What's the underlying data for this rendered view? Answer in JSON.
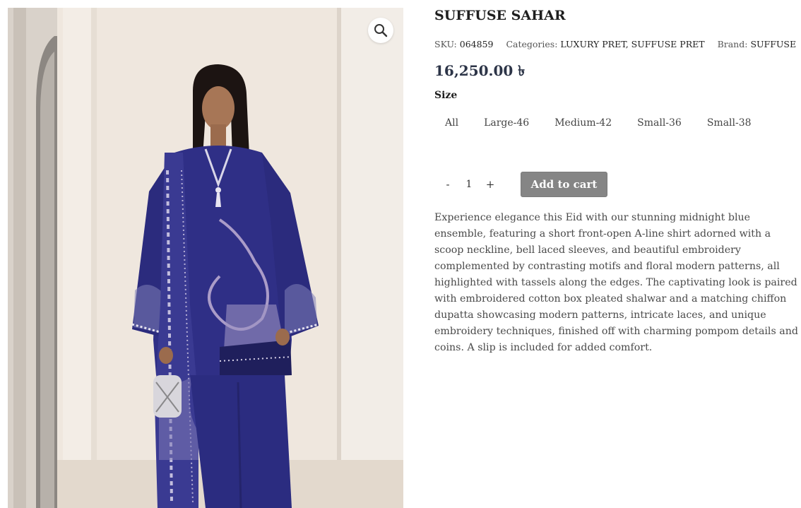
{
  "product": {
    "title": "SUFFUSE SAHAR",
    "sku_label": "SKU:",
    "sku": "064859",
    "categories_label": "Categories:",
    "categories": "LUXURY PRET, SUFFUSE PRET",
    "brand_label": "Brand:",
    "brand": "SUFFUSE",
    "price": "16,250.00 ৳",
    "description": "Experience elegance this Eid with our stunning midnight blue ensemble, featuring a short front-open A-line shirt adorned with a scoop neckline, bell laced sleeves, and beautiful embroidery complemented by contrasting motifs and floral modern patterns, all highlighted with tassels along the edges. The captivating look is paired with embroidered cotton box pleated shalwar and a matching chiffon dupatta showcasing modern patterns, intricate laces, and unique embroidery techniques, finished off with charming pompom details and coins. A slip is included for added comfort."
  },
  "size": {
    "label": "Size",
    "options": [
      "All",
      "Large-46",
      "Medium-42",
      "Small-36",
      "Small-38"
    ]
  },
  "cart": {
    "minus": "-",
    "quantity": "1",
    "plus": "+",
    "add_label": "Add to cart"
  },
  "gallery": {
    "zoom_icon": "magnifier-icon",
    "image": "model-in-midnight-blue-embroidered-suit"
  },
  "colors": {
    "fabric": "#2f2f86",
    "button": "#858585",
    "price": "#2c3447"
  }
}
